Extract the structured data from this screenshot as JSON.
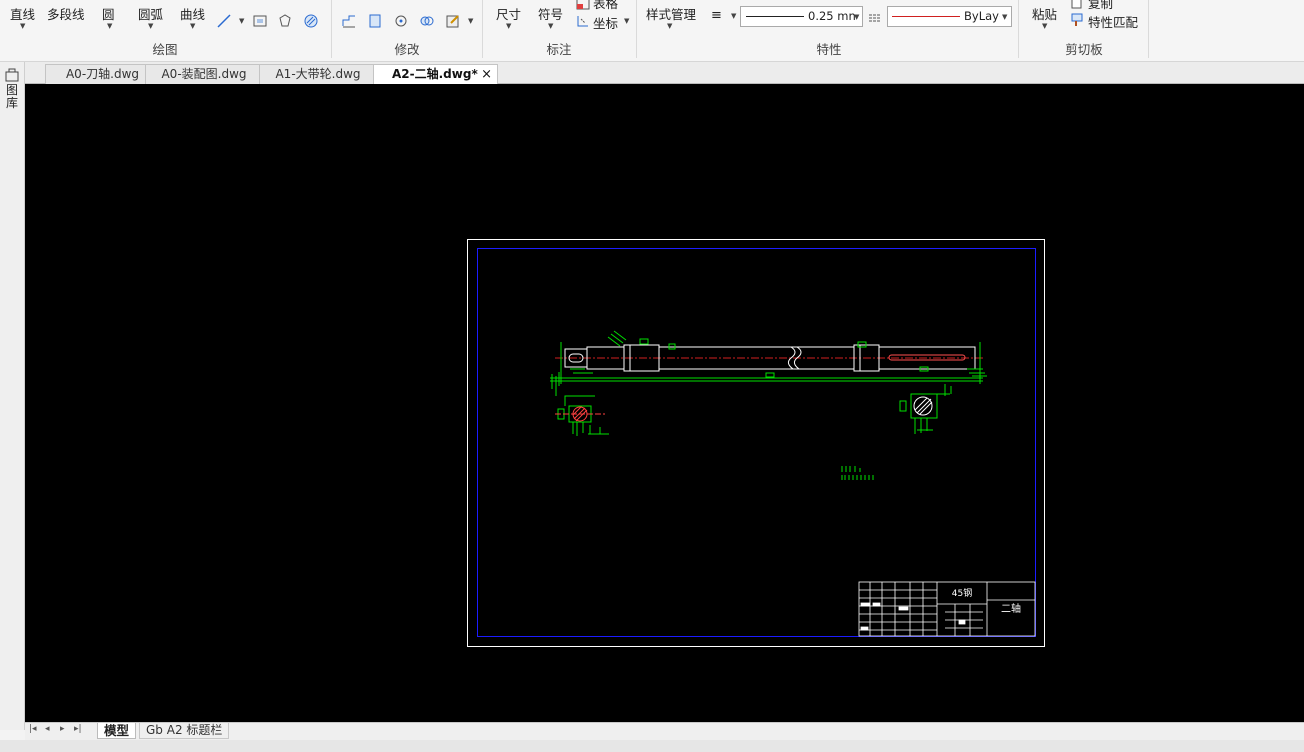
{
  "ribbon": {
    "draw": {
      "line": "直线",
      "polyline": "多段线",
      "circle": "圆",
      "arc": "圆弧",
      "curve": "曲线",
      "group": "绘图"
    },
    "modify": {
      "group": "修改"
    },
    "annotate": {
      "dimension": "尺寸",
      "symbol": "符号",
      "table": "表格",
      "coordinate": "坐标",
      "group": "标注"
    },
    "properties": {
      "style_manager": "样式管理",
      "lineweight": "0.25 mn",
      "linetype": "ByLay‹",
      "group": "特性"
    },
    "clipboard": {
      "paste": "粘贴",
      "copy": "复制",
      "match_properties": "特性匹配",
      "group": "剪切板"
    }
  },
  "sidebar": {
    "label": "图库"
  },
  "tabs": [
    {
      "label": "A0-刀轴.dwg",
      "active": false
    },
    {
      "label": "A0-装配图.dwg",
      "active": false
    },
    {
      "label": "A1-大带轮.dwg",
      "active": false
    },
    {
      "label": "A2-二轴.dwg*",
      "active": true
    }
  ],
  "close_glyph": "×",
  "drawing": {
    "material": "45钢",
    "part_name": "二轴"
  },
  "layout_tabs": {
    "model": "模型",
    "layout": "Gb A2 标题栏"
  },
  "colors": {
    "canvas": "#000000",
    "frame": "#ffffff",
    "inner_frame": "#1c1cff",
    "geometry": "#00e000",
    "section_hatch": "#ff4040"
  }
}
